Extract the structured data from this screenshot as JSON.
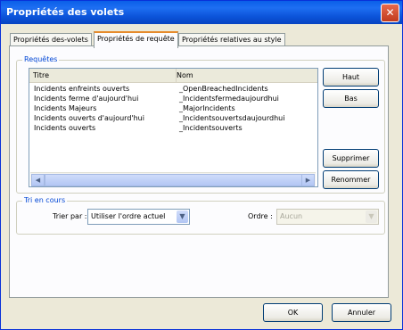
{
  "window": {
    "title": "Propriétés des volets",
    "close_glyph": "✕"
  },
  "tabs": [
    {
      "label": "Propriétés des-volets"
    },
    {
      "label": "Propriétés de requête"
    },
    {
      "label": "Propriétés relatives au style"
    }
  ],
  "queries_group": {
    "label": "Requêtes"
  },
  "list": {
    "columns": [
      "Titre",
      "Nom"
    ],
    "rows": [
      [
        "Incidents enfreints ouverts",
        "_OpenBreachedIncidents"
      ],
      [
        "Incidents ferme d'aujourd'hui",
        "_Incidentsfermedaujourdhui"
      ],
      [
        "Incidents Majeurs",
        "_MajorIncidents"
      ],
      [
        "Incidents ouverts d'aujourd'hui",
        "_Incidentsouvertsdaujourdhui"
      ],
      [
        "Incidents ouverts",
        "_Incidentsouverts"
      ]
    ]
  },
  "scroll": {
    "left": "◀",
    "right": "▶"
  },
  "buttons": {
    "up": "Haut",
    "down": "Bas",
    "delete": "Supprimer",
    "rename": "Renommer",
    "ok": "OK",
    "cancel": "Annuler"
  },
  "sort_group": {
    "label": "Tri en cours",
    "sort_by_label": "Trier par :",
    "sort_by_value": "Utiliser l'ordre actuel",
    "order_label": "Ordre :",
    "order_value": "Aucun",
    "dropdown_glyph": "▼"
  }
}
